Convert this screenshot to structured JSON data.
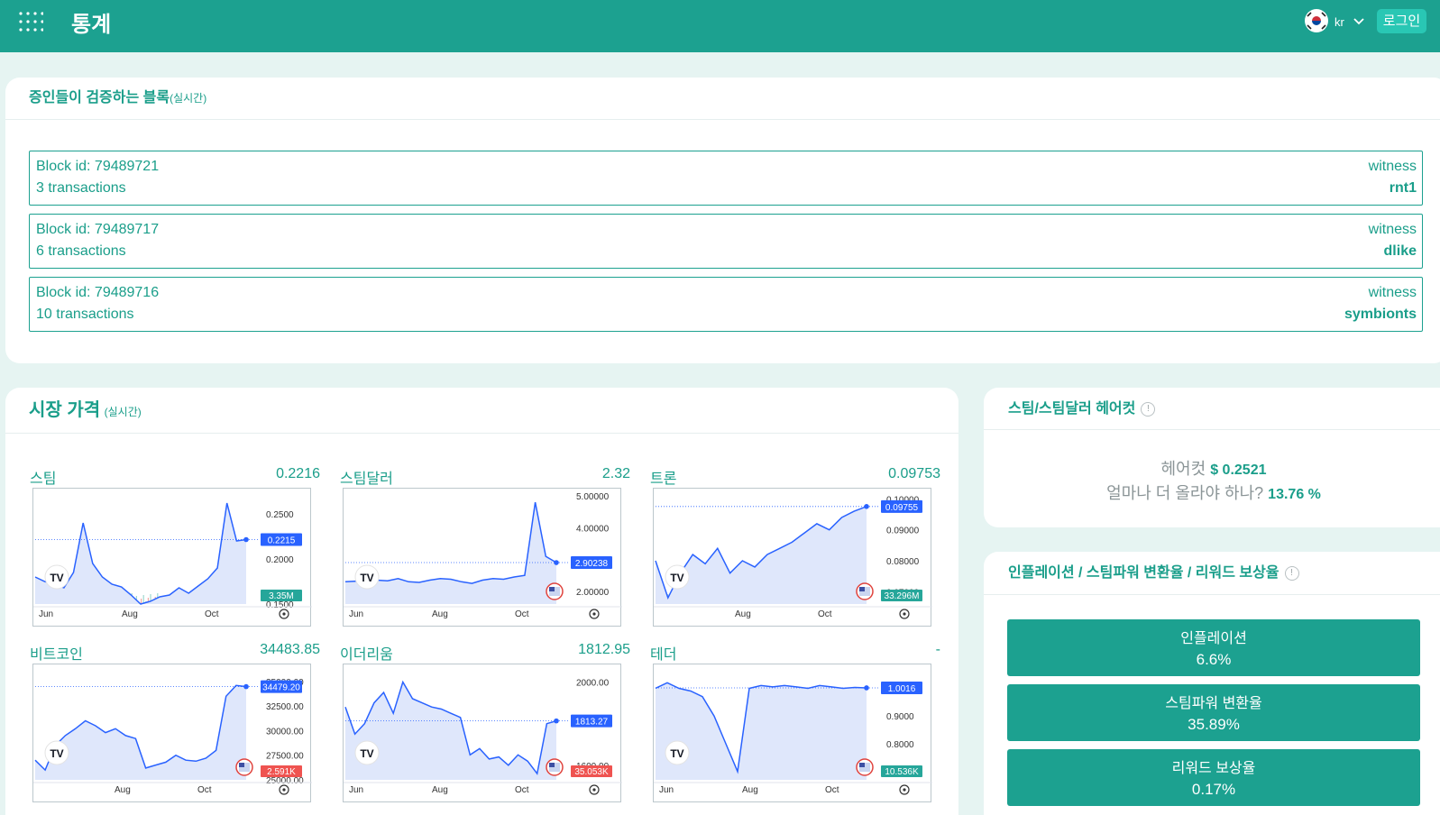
{
  "header": {
    "title": "통계",
    "lang": "kr",
    "login_label": "로그인"
  },
  "blocks": {
    "title": "증인들이 검증하는 블록",
    "subtitle": "(실시간)",
    "items": [
      {
        "id": "Block id: 79489721",
        "tx": "3 transactions",
        "witness_label": "witness",
        "witness": "rnt1"
      },
      {
        "id": "Block id: 79489717",
        "tx": "6 transactions",
        "witness_label": "witness",
        "witness": "dlike"
      },
      {
        "id": "Block id: 79489716",
        "tx": "10 transactions",
        "witness_label": "witness",
        "witness": "symbionts"
      }
    ]
  },
  "market": {
    "title": "시장 가격",
    "subtitle": "(실시간)",
    "items": [
      {
        "name": "스팀",
        "price": "0.2216"
      },
      {
        "name": "스팀달러",
        "price": "2.32"
      },
      {
        "name": "트론",
        "price": "0.09753"
      },
      {
        "name": "비트코인",
        "price": "34483.85"
      },
      {
        "name": "이더리움",
        "price": "1812.95"
      },
      {
        "name": "테더",
        "price": "-"
      }
    ]
  },
  "chart_data": [
    {
      "type": "area",
      "name": "스팀",
      "x_ticks": [
        "Jun",
        "Aug",
        "Oct"
      ],
      "y_ticks": [
        "0.2500",
        "0.2000",
        "0.1500"
      ],
      "ylim": [
        0.15,
        0.27
      ],
      "current": "0.2215",
      "volume": "3.35M",
      "values": [
        0.18,
        0.175,
        0.172,
        0.168,
        0.185,
        0.24,
        0.195,
        0.18,
        0.172,
        0.169,
        0.16,
        0.15,
        0.153,
        0.158,
        0.16,
        0.168,
        0.162,
        0.17,
        0.178,
        0.19,
        0.262,
        0.22,
        0.2215
      ]
    },
    {
      "type": "area",
      "name": "스팀달러",
      "x_ticks": [
        "Jun",
        "Aug",
        "Oct"
      ],
      "y_ticks": [
        "5.00000",
        "4.00000",
        "3.00000",
        "2.00000"
      ],
      "ylim": [
        1.6,
        5.0
      ],
      "current": "2.90238",
      "volume": "",
      "values": [
        2.3,
        2.32,
        2.28,
        2.35,
        2.33,
        2.4,
        2.3,
        2.28,
        2.35,
        2.4,
        2.38,
        2.3,
        2.25,
        2.35,
        2.4,
        2.38,
        2.45,
        2.5,
        4.8,
        3.1,
        2.90238
      ]
    },
    {
      "type": "area",
      "name": "트론",
      "x_ticks": [
        "Aug",
        "Oct"
      ],
      "y_ticks": [
        "0.10000",
        "0.09000",
        "0.08000",
        "0.07000"
      ],
      "ylim": [
        0.066,
        0.101
      ],
      "current": "0.09755",
      "volume": "33.296M",
      "values": [
        0.08,
        0.068,
        0.076,
        0.082,
        0.079,
        0.084,
        0.076,
        0.08,
        0.078,
        0.082,
        0.084,
        0.086,
        0.089,
        0.092,
        0.09,
        0.094,
        0.096,
        0.09755
      ]
    },
    {
      "type": "area",
      "name": "비트코인",
      "x_ticks": [
        "Aug",
        "Oct"
      ],
      "y_ticks": [
        "35000.00",
        "32500.00",
        "30000.00",
        "27500.00",
        "25000.00"
      ],
      "ylim": [
        25000,
        36000
      ],
      "current": "34479.20",
      "volume": "2.591K",
      "values": [
        27000,
        26000,
        28500,
        29500,
        30200,
        31000,
        30500,
        29800,
        30200,
        29500,
        29200,
        26200,
        26500,
        26800,
        27500,
        27000,
        26900,
        27200,
        28000,
        33500,
        34600,
        34479.2
      ]
    },
    {
      "type": "area",
      "name": "이더리움",
      "x_ticks": [
        "Jun",
        "Aug",
        "Oct"
      ],
      "y_ticks": [
        "2000.00",
        "1800.00",
        "1600.00"
      ],
      "ylim": [
        1530,
        2050
      ],
      "current": "1813.27",
      "volume": "35.053K",
      "values": [
        1880,
        1750,
        1800,
        1900,
        1950,
        1850,
        2000,
        1920,
        1900,
        1880,
        1870,
        1850,
        1830,
        1650,
        1680,
        1630,
        1640,
        1600,
        1650,
        1620,
        1560,
        1800,
        1813.27
      ]
    },
    {
      "type": "area",
      "name": "테더",
      "x_ticks": [
        "Jun",
        "Aug",
        "Oct"
      ],
      "y_ticks": [
        "1.0000",
        "0.9000",
        "0.8000",
        "0.7000"
      ],
      "ylim": [
        0.67,
        1.06
      ],
      "current": "1.0016",
      "volume": "10.536K",
      "values": [
        1.0,
        1.02,
        1.0,
        0.99,
        0.97,
        0.9,
        0.8,
        0.7,
        1.0,
        1.01,
        1.005,
        1.01,
        1.005,
        1.0,
        1.01,
        1.005,
        1.0,
        1.003,
        1.0016
      ]
    }
  ],
  "haircut": {
    "title": "스팀/스팀달러 헤어컷",
    "line1_label": "헤어컷",
    "line1_value": "$ 0.2521",
    "line2_label": "얼마나 더 올라야 하나?",
    "line2_value": "13.76 %"
  },
  "rates": {
    "title": "인플레이션 / 스팀파워 변환율 / 리워드 보상율",
    "items": [
      {
        "label": "인플레이션",
        "value": "6.6%"
      },
      {
        "label": "스팀파워 변환율",
        "value": "35.89%"
      },
      {
        "label": "리워드 보상율",
        "value": "0.17%"
      }
    ]
  },
  "icons": {
    "menu": "grid-menu-icon",
    "flag": "korea-flag-icon",
    "info": "info-icon"
  },
  "colors": {
    "primary": "#1ca190",
    "accent": "#29c7b4",
    "line": "#2962ff",
    "down": "#ef5350"
  }
}
